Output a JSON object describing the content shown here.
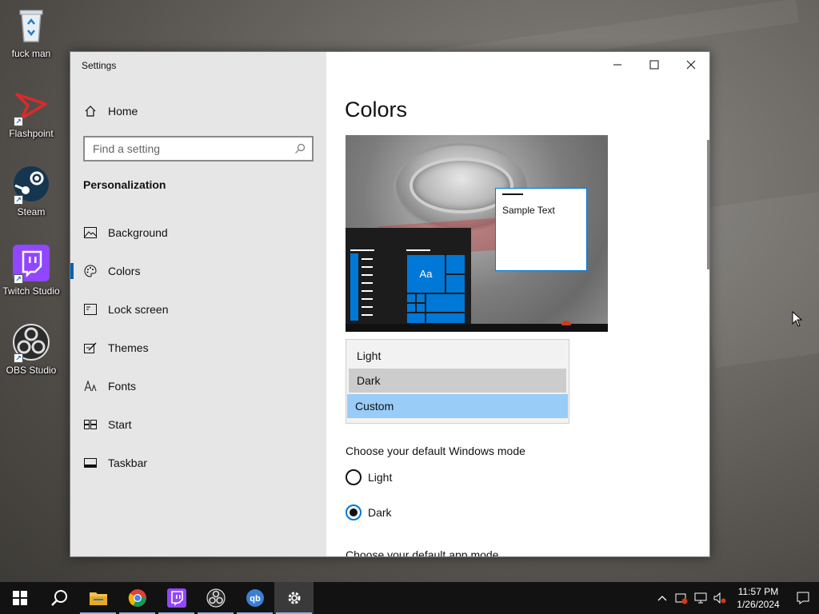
{
  "desktop": {
    "icons": [
      {
        "label": "fuck man",
        "icon": "recycle-bin-icon"
      },
      {
        "label": "Flashpoint",
        "icon": "flashpoint-icon"
      },
      {
        "label": "Steam",
        "icon": "steam-icon"
      },
      {
        "label": "Twitch Studio",
        "icon": "twitch-icon"
      },
      {
        "label": "OBS Studio",
        "icon": "obs-icon"
      }
    ]
  },
  "window": {
    "title": "Settings",
    "controls": [
      "minimize-icon",
      "maximize-icon",
      "close-icon"
    ]
  },
  "sidebar": {
    "home_label": "Home",
    "search_placeholder": "Find a setting",
    "section_title": "Personalization",
    "items": [
      {
        "label": "Background",
        "icon": "picture-icon"
      },
      {
        "label": "Colors",
        "icon": "palette-icon",
        "active": true
      },
      {
        "label": "Lock screen",
        "icon": "lock-screen-icon"
      },
      {
        "label": "Themes",
        "icon": "themes-icon"
      },
      {
        "label": "Fonts",
        "icon": "fonts-icon"
      },
      {
        "label": "Start",
        "icon": "start-icon"
      },
      {
        "label": "Taskbar",
        "icon": "taskbar-icon"
      }
    ]
  },
  "main": {
    "title": "Colors",
    "preview": {
      "sample_text": "Sample Text",
      "tile_text": "Aa"
    },
    "color_dropdown": {
      "options": [
        "Light",
        "Dark",
        "Custom"
      ],
      "selected": "Custom"
    },
    "windows_mode": {
      "label": "Choose your default Windows mode",
      "options": [
        "Light",
        "Dark"
      ],
      "selected": "Dark"
    },
    "app_mode": {
      "label": "Choose your default app mode"
    }
  },
  "taskbar": {
    "apps": [
      "windows-start-icon",
      "search-icon",
      "file-explorer-icon",
      "chrome-icon",
      "twitch-studio-icon",
      "obs-icon",
      "qbittorrent-icon",
      "settings-gear-icon"
    ],
    "time": "11:57 PM",
    "date": "1/26/2024"
  },
  "colors": {
    "accent": "#0078d7",
    "sidebar_bg": "#e6e6e6",
    "selection": "#99ccf7"
  }
}
